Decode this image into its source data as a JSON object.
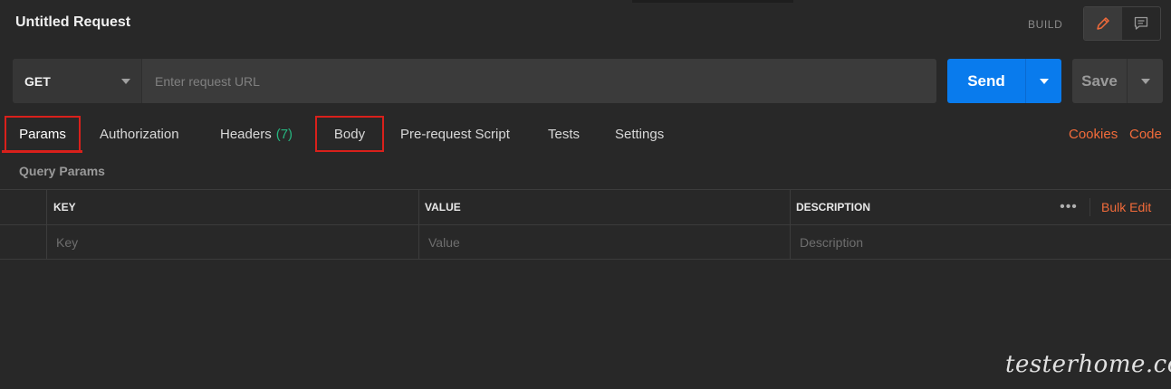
{
  "header": {
    "title": "Untitled Request",
    "mode_label": "BUILD",
    "mode_buttons": [
      {
        "icon": "pencil-icon",
        "active": true
      },
      {
        "icon": "comment-icon",
        "active": false
      }
    ]
  },
  "request": {
    "method": "GET",
    "url_value": "",
    "url_placeholder": "Enter request URL"
  },
  "actions": {
    "send_label": "Send",
    "save_label": "Save"
  },
  "tabs": [
    {
      "label": "Params"
    },
    {
      "label": "Authorization"
    },
    {
      "label": "Headers",
      "count": "(7)"
    },
    {
      "label": "Body"
    },
    {
      "label": "Pre-request Script"
    },
    {
      "label": "Tests"
    },
    {
      "label": "Settings"
    }
  ],
  "links": {
    "cookies": "Cookies",
    "code": "Code"
  },
  "query_params": {
    "section_title": "Query Params",
    "columns": [
      "KEY",
      "VALUE",
      "DESCRIPTION"
    ],
    "more_label": "•••",
    "bulk_edit_label": "Bulk Edit",
    "placeholders": {
      "key": "Key",
      "value": "Value",
      "description": "Description"
    }
  },
  "watermark": "testerhome.com",
  "colors": {
    "background": "#282828",
    "accent": "#f26b3a",
    "send_blue": "#097bed",
    "highlight_red": "#d9201b",
    "count_green": "#26b47f"
  }
}
